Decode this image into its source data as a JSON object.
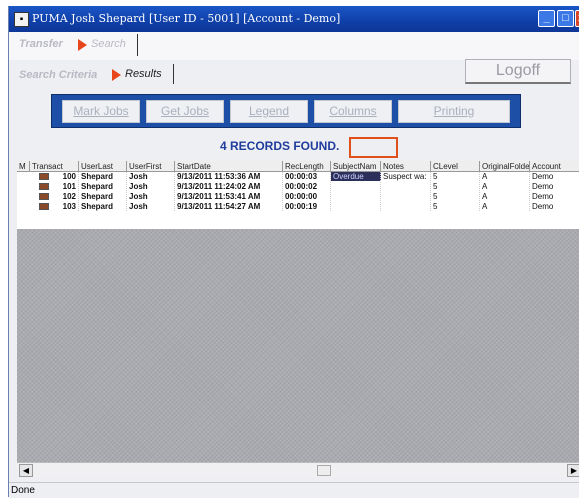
{
  "window": {
    "title": "PUMA   Josh Shepard [User ID - 5001] [Account - Demo]"
  },
  "nav": {
    "transfer": "Transfer",
    "search": "Search",
    "search_criteria": "Search Criteria",
    "results": "Results",
    "logoff": "Logoff"
  },
  "toolbar": {
    "mark_jobs": "Mark Jobs",
    "get_jobs": "Get Jobs",
    "legend": "Legend",
    "columns": "Columns",
    "printing": "Printing"
  },
  "records_label": "4 RECORDS FOUND.",
  "table": {
    "columns": [
      "M",
      "Transact",
      "UserLast",
      "UserFirst",
      "StartDate",
      "RecLength",
      "SubjectNam",
      "Notes",
      "CLevel",
      "OriginalFolde",
      "Account"
    ],
    "rows": [
      [
        "",
        "100",
        "Shepard",
        "Josh",
        "9/13/2011 11:53:36 AM",
        "00:00:03",
        "Overdue",
        "Suspect wa:",
        "5",
        "A",
        "Demo"
      ],
      [
        "",
        "101",
        "Shepard",
        "Josh",
        "9/13/2011 11:24:02 AM",
        "00:00:02",
        "",
        "",
        "5",
        "A",
        "Demo"
      ],
      [
        "",
        "102",
        "Shepard",
        "Josh",
        "9/13/2011 11:53:41 AM",
        "00:00:00",
        "",
        "",
        "5",
        "A",
        "Demo"
      ],
      [
        "",
        "103",
        "Shepard",
        "Josh",
        "9/13/2011 11:54:27 AM",
        "00:00:19",
        "",
        "",
        "5",
        "A",
        "Demo"
      ]
    ]
  },
  "status": "Done",
  "colors": {
    "titlebar": "#0f3fa8",
    "toolbar": "#1c4fa5",
    "records": "#1f3c9c",
    "highlight": "#e0501c"
  }
}
